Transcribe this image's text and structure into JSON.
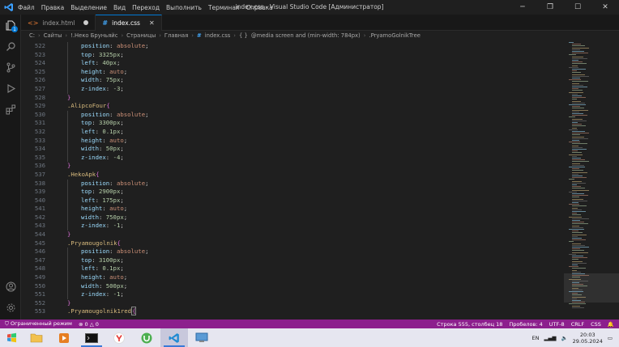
{
  "titlebar": {
    "menu": [
      "Файл",
      "Правка",
      "Выделение",
      "Вид",
      "Переход",
      "Выполнить",
      "Терминал",
      "Справка"
    ],
    "title": "index.css - Visual Studio Code [Администратор]",
    "controls": [
      "minimize-icon",
      "restore-icon",
      "maximize-icon",
      "close-icon"
    ]
  },
  "activitybar": {
    "top": [
      "explorer-icon",
      "search-icon",
      "source-control-icon",
      "run-debug-icon",
      "extensions-icon"
    ],
    "badge": "1",
    "bottom": [
      "account-icon",
      "settings-gear-icon"
    ]
  },
  "tabs": [
    {
      "label": "index.html",
      "icon": "<>",
      "modified": true
    },
    {
      "label": "index.css",
      "icon": "#",
      "active": true
    }
  ],
  "breadcrumb": [
    "C:",
    "Сайты",
    "!.Неко Бруньяйс",
    "Страницы",
    "Главная",
    "index.css",
    "@media screen and (min-width: 784px)",
    ".PryamoGolnikTree"
  ],
  "editor": {
    "line_numbers": [
      "522",
      "523",
      "524",
      "525",
      "526",
      "527",
      "528",
      "529",
      "530",
      "531",
      "532",
      "533",
      "534",
      "535",
      "536",
      "537",
      "538",
      "539",
      "540",
      "541",
      "542",
      "543",
      "544",
      "545",
      "546",
      "547",
      "548",
      "549",
      "550",
      "551",
      "552",
      "553"
    ],
    "lines": [
      {
        "indent": 2,
        "prop": "position",
        "val": "absolute",
        "type": "kw"
      },
      {
        "indent": 2,
        "prop": "top",
        "val": "3325px",
        "type": "num"
      },
      {
        "indent": 2,
        "prop": "left",
        "val": "40px",
        "type": "num"
      },
      {
        "indent": 2,
        "prop": "height",
        "val": "auto",
        "type": "kw"
      },
      {
        "indent": 2,
        "prop": "width",
        "val": "75px",
        "type": "num"
      },
      {
        "indent": 2,
        "prop": "z-index",
        "val": "-3",
        "type": "num"
      },
      {
        "indent": 1,
        "close": "}"
      },
      {
        "indent": 1,
        "sel": ".AlipcoFour",
        "open": "{"
      },
      {
        "indent": 2,
        "prop": "position",
        "val": "absolute",
        "type": "kw"
      },
      {
        "indent": 2,
        "prop": "top",
        "val": "3300px",
        "type": "num"
      },
      {
        "indent": 2,
        "prop": "left",
        "val": "0.1px",
        "type": "num"
      },
      {
        "indent": 2,
        "prop": "height",
        "val": "auto",
        "type": "kw"
      },
      {
        "indent": 2,
        "prop": "width",
        "val": "50px",
        "type": "num"
      },
      {
        "indent": 2,
        "prop": "z-index",
        "val": "-4",
        "type": "num"
      },
      {
        "indent": 1,
        "close": "}"
      },
      {
        "indent": 1,
        "sel": ".HekoApk",
        "open": "{"
      },
      {
        "indent": 2,
        "prop": "position",
        "val": "absolute",
        "type": "kw"
      },
      {
        "indent": 2,
        "prop": "top",
        "val": "2900px",
        "type": "num"
      },
      {
        "indent": 2,
        "prop": "left",
        "val": "175px",
        "type": "num"
      },
      {
        "indent": 2,
        "prop": "height",
        "val": "auto",
        "type": "kw"
      },
      {
        "indent": 2,
        "prop": "width",
        "val": "750px",
        "type": "num"
      },
      {
        "indent": 2,
        "prop": "z-index",
        "val": "-1",
        "type": "num"
      },
      {
        "indent": 1,
        "close": "}"
      },
      {
        "indent": 1,
        "sel": ".Pryamougolnik",
        "open": "{"
      },
      {
        "indent": 2,
        "prop": "position",
        "val": "absolute",
        "type": "kw"
      },
      {
        "indent": 2,
        "prop": "top",
        "val": "3100px",
        "type": "num"
      },
      {
        "indent": 2,
        "prop": "left",
        "val": "0.1px",
        "type": "num"
      },
      {
        "indent": 2,
        "prop": "height",
        "val": "auto",
        "type": "kw"
      },
      {
        "indent": 2,
        "prop": "width",
        "val": "500px",
        "type": "num"
      },
      {
        "indent": 2,
        "prop": "z-index",
        "val": "-1",
        "type": "num"
      },
      {
        "indent": 1,
        "close": "}"
      },
      {
        "indent": 1,
        "sel": ".Pryamougolnik1red",
        "open": "{",
        "cursor": true
      }
    ]
  },
  "statusbar": {
    "left": {
      "restricted": "Ограниченный режим",
      "errors": "0",
      "warnings": "0"
    },
    "right": [
      "Строка 555, столбец 18",
      "Пробелов: 4",
      "UTF-8",
      "CRLF",
      "CSS"
    ]
  },
  "taskbar": {
    "apps": [
      "windows-start-icon",
      "file-explorer-icon",
      "media-player-icon",
      "terminal-icon",
      "yandex-browser-icon",
      "utorrent-icon",
      "vscode-icon",
      "remote-desktop-icon"
    ],
    "active_app": 6,
    "lang": "EN",
    "time": "20:03",
    "date": "29.05.2024"
  },
  "colors": {
    "status_bar": "#8c1f8d",
    "property": "#9cdcfe",
    "value_keyword": "#ce9178",
    "value_number": "#b5cea8",
    "selector": "#d7ba7d"
  }
}
